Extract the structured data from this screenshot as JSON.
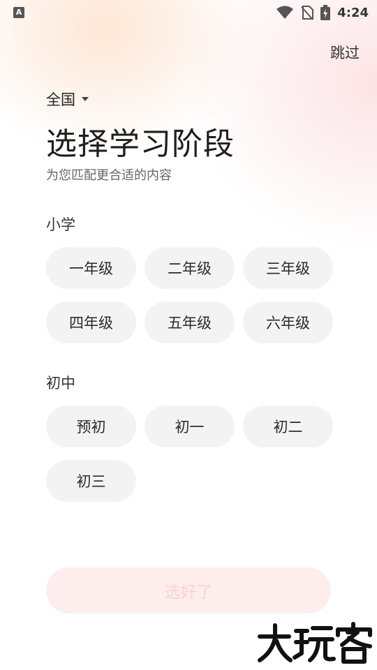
{
  "status_bar": {
    "app_icon": "A",
    "time": "4:24",
    "icons": [
      "wifi-icon",
      "no-sim-icon",
      "battery-charging-icon"
    ]
  },
  "header": {
    "skip_label": "跳过",
    "region_label": "全国",
    "title": "选择学习阶段",
    "subtitle": "为您匹配更合适的内容"
  },
  "sections": [
    {
      "title": "小学",
      "options": [
        "一年级",
        "二年级",
        "三年级",
        "四年级",
        "五年级",
        "六年级"
      ]
    },
    {
      "title": "初中",
      "options": [
        "预初",
        "初一",
        "初二",
        "初三"
      ]
    }
  ],
  "confirm_button": {
    "label": "选好了",
    "enabled": false
  },
  "watermark": "大玩客",
  "colors": {
    "chip_bg": "#f3f3f3",
    "confirm_bg_disabled": "#fdeded",
    "confirm_text_disabled": "#f9d3d3"
  }
}
